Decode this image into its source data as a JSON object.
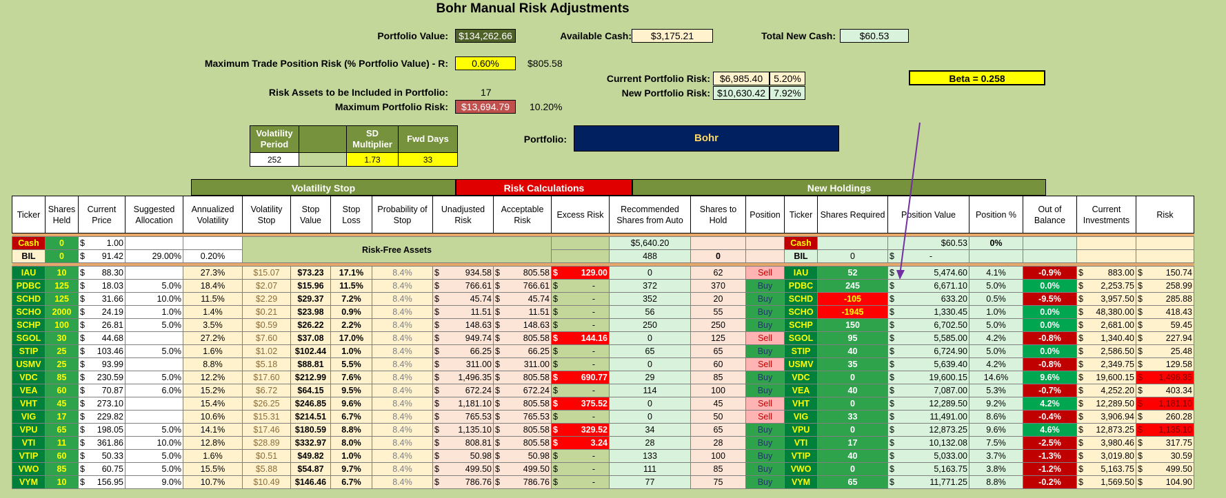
{
  "title": "Bohr Manual Risk Adjustments",
  "top": {
    "portfolio_value_label": "Portfolio Value:",
    "portfolio_value": "$134,262.66",
    "available_cash_label": "Available Cash:",
    "available_cash": "$3,175.21",
    "total_new_cash_label": "Total New Cash:",
    "total_new_cash": "$60.53",
    "max_trade_label": "Maximum Trade Position Risk (% Portfolio Value) - R:",
    "max_trade_pct": "0.60%",
    "max_trade_value": "$805.58",
    "risk_assets_label": "Risk Assets to be Included in Portfolio:",
    "risk_assets": "17",
    "max_portfolio_risk_label": "Maximum Portfolio Risk:",
    "max_portfolio_risk": "$13,694.79",
    "max_portfolio_risk_pct": "10.20%",
    "current_risk_label": "Current Portfolio Risk:",
    "current_risk": "$6,985.40",
    "current_risk_pct": "5.20%",
    "new_risk_label": "New Portfolio Risk:",
    "new_risk": "$10,630.42",
    "new_risk_pct": "7.92%",
    "beta": "Beta = 0.258",
    "portfolio_label": "Portfolio:",
    "portfolio_name": "Bohr"
  },
  "params": {
    "h1": "Volatility Period",
    "h2": "",
    "h3": "SD Multiplier",
    "h4": "Fwd Days",
    "v1": "252",
    "v2": "",
    "v3": "1.73",
    "v4": "33"
  },
  "groups": {
    "vol_stop": "Volatility Stop",
    "risk_calc": "Risk Calculations",
    "new_holdings": "New Holdings"
  },
  "headers": [
    "Ticker",
    "Shares Held",
    "Current Price",
    "Suggested Allocation",
    "Annualized Volatility",
    "Volatility Stop",
    "Stop Value",
    "Stop Loss",
    "Probability of Stop",
    "Unadjusted Risk",
    "Acceptable Risk",
    "Excess Risk",
    "Recommended Shares from Auto",
    "Shares to Hold",
    "Position",
    "Ticker",
    "Shares Required",
    "Position Value",
    "Position %",
    "Out of Balance",
    "Current Investments",
    "Risk"
  ],
  "cash_row": {
    "ticker": "Cash",
    "shares": "0",
    "price": "1.00",
    "rec": "$5,640.20",
    "ticker2": "Cash",
    "pv": "$60.53",
    "pp": "0%"
  },
  "bil_row": {
    "ticker": "BIL",
    "shares": "0",
    "price": "91.42",
    "alloc": "29.00%",
    "vol": "0.20%",
    "rec": "488",
    "hold": "0",
    "ticker2": "BIL",
    "req": "0",
    "pv": "-"
  },
  "risk_free_label": "Risk-Free Assets",
  "rows": [
    [
      "IAU",
      "10",
      "88.30",
      "",
      "27.3%",
      "$15.07",
      "$73.23",
      "17.1%",
      "8.4%",
      "934.58",
      "805.58",
      "129.00",
      "0",
      "62",
      "Sell",
      "IAU",
      "52",
      "5,474.60",
      "4.1%",
      "-0.9%",
      "883.00",
      "150.74"
    ],
    [
      "PDBC",
      "125",
      "18.03",
      "5.0%",
      "18.4%",
      "$2.07",
      "$15.96",
      "11.5%",
      "8.4%",
      "766.61",
      "766.61",
      "-",
      "372",
      "370",
      "Buy",
      "PDBC",
      "245",
      "6,671.10",
      "5.0%",
      "0.0%",
      "2,253.75",
      "258.99"
    ],
    [
      "SCHD",
      "125",
      "31.66",
      "10.0%",
      "11.5%",
      "$2.29",
      "$29.37",
      "7.2%",
      "8.4%",
      "45.74",
      "45.74",
      "-",
      "352",
      "20",
      "Buy",
      "SCHD",
      "-105",
      "633.20",
      "0.5%",
      "-9.5%",
      "3,957.50",
      "285.88"
    ],
    [
      "SCHO",
      "2000",
      "24.19",
      "1.0%",
      "1.4%",
      "$0.21",
      "$23.98",
      "0.9%",
      "8.4%",
      "11.51",
      "11.51",
      "-",
      "56",
      "55",
      "Buy",
      "SCHO",
      "-1945",
      "1,330.45",
      "1.0%",
      "0.0%",
      "48,380.00",
      "418.43"
    ],
    [
      "SCHP",
      "100",
      "26.81",
      "5.0%",
      "3.5%",
      "$0.59",
      "$26.22",
      "2.2%",
      "8.4%",
      "148.63",
      "148.63",
      "-",
      "250",
      "250",
      "Buy",
      "SCHP",
      "150",
      "6,702.50",
      "5.0%",
      "0.0%",
      "2,681.00",
      "59.45"
    ],
    [
      "SGOL",
      "30",
      "44.68",
      "",
      "27.2%",
      "$7.60",
      "$37.08",
      "17.0%",
      "8.4%",
      "949.74",
      "805.58",
      "144.16",
      "0",
      "125",
      "Sell",
      "SGOL",
      "95",
      "5,585.00",
      "4.2%",
      "-0.8%",
      "1,340.40",
      "227.94"
    ],
    [
      "STIP",
      "25",
      "103.46",
      "5.0%",
      "1.6%",
      "$1.02",
      "$102.44",
      "1.0%",
      "8.4%",
      "66.25",
      "66.25",
      "-",
      "65",
      "65",
      "Buy",
      "STIP",
      "40",
      "6,724.90",
      "5.0%",
      "0.0%",
      "2,586.50",
      "25.48"
    ],
    [
      "USMV",
      "25",
      "93.99",
      "",
      "8.8%",
      "$5.18",
      "$88.81",
      "5.5%",
      "8.4%",
      "311.00",
      "311.00",
      "-",
      "0",
      "60",
      "Sell",
      "USMV",
      "35",
      "5,639.40",
      "4.2%",
      "-0.8%",
      "2,349.75",
      "129.58"
    ],
    [
      "VDC",
      "85",
      "230.59",
      "5.0%",
      "12.2%",
      "$17.60",
      "$212.99",
      "7.6%",
      "8.4%",
      "1,496.35",
      "805.58",
      "690.77",
      "29",
      "85",
      "Buy",
      "VDC",
      "0",
      "19,600.15",
      "14.6%",
      "9.6%",
      "19,600.15",
      "1,496.35"
    ],
    [
      "VEA",
      "60",
      "70.87",
      "6.0%",
      "15.2%",
      "$6.72",
      "$64.15",
      "9.5%",
      "8.4%",
      "672.24",
      "672.24",
      "-",
      "114",
      "100",
      "Buy",
      "VEA",
      "40",
      "7,087.00",
      "5.3%",
      "-0.7%",
      "4,252.20",
      "403.34"
    ],
    [
      "VHT",
      "45",
      "273.10",
      "",
      "15.4%",
      "$26.25",
      "$246.85",
      "9.6%",
      "8.4%",
      "1,181.10",
      "805.58",
      "375.52",
      "0",
      "45",
      "Sell",
      "VHT",
      "0",
      "12,289.50",
      "9.2%",
      "4.2%",
      "12,289.50",
      "1,181.10"
    ],
    [
      "VIG",
      "17",
      "229.82",
      "",
      "10.6%",
      "$15.31",
      "$214.51",
      "6.7%",
      "8.4%",
      "765.53",
      "765.53",
      "-",
      "0",
      "50",
      "Sell",
      "VIG",
      "33",
      "11,491.00",
      "8.6%",
      "-0.4%",
      "3,906.94",
      "260.28"
    ],
    [
      "VPU",
      "65",
      "198.05",
      "5.0%",
      "14.1%",
      "$17.46",
      "$180.59",
      "8.8%",
      "8.4%",
      "1,135.10",
      "805.58",
      "329.52",
      "34",
      "65",
      "Buy",
      "VPU",
      "0",
      "12,873.25",
      "9.6%",
      "4.6%",
      "12,873.25",
      "1,135.10"
    ],
    [
      "VTI",
      "11",
      "361.86",
      "10.0%",
      "12.8%",
      "$28.89",
      "$332.97",
      "8.0%",
      "8.4%",
      "808.81",
      "805.58",
      "3.24",
      "28",
      "28",
      "Buy",
      "VTI",
      "17",
      "10,132.08",
      "7.5%",
      "-2.5%",
      "3,980.46",
      "317.75"
    ],
    [
      "VTIP",
      "60",
      "50.33",
      "5.0%",
      "1.6%",
      "$0.51",
      "$49.82",
      "1.0%",
      "8.4%",
      "50.98",
      "50.98",
      "-",
      "133",
      "100",
      "Buy",
      "VTIP",
      "40",
      "5,033.00",
      "3.7%",
      "-1.3%",
      "3,019.80",
      "30.59"
    ],
    [
      "VWO",
      "85",
      "60.75",
      "5.0%",
      "15.5%",
      "$5.88",
      "$54.87",
      "9.7%",
      "8.4%",
      "499.50",
      "499.50",
      "-",
      "111",
      "85",
      "Buy",
      "VWO",
      "0",
      "5,163.75",
      "3.8%",
      "-1.2%",
      "5,163.75",
      "499.50"
    ],
    [
      "VYM",
      "10",
      "156.95",
      "9.0%",
      "10.7%",
      "$10.49",
      "$146.46",
      "6.7%",
      "8.4%",
      "786.76",
      "786.76",
      "-",
      "77",
      "75",
      "Buy",
      "VYM",
      "65",
      "11,771.25",
      "8.8%",
      "-0.2%",
      "1,569.50",
      "104.90"
    ]
  ]
}
